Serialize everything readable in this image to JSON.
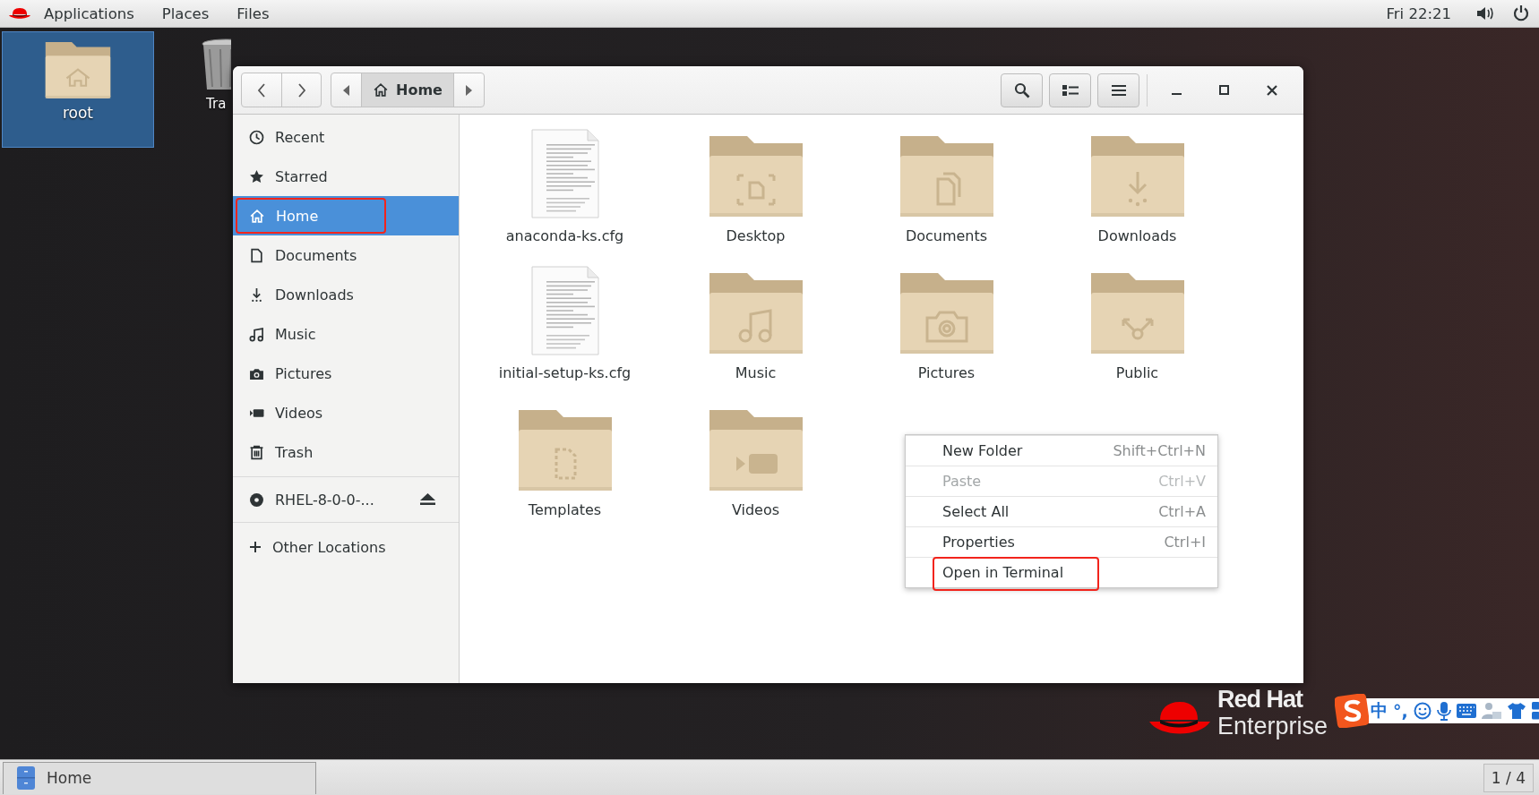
{
  "top_bar": {
    "menus": [
      "Applications",
      "Places",
      "Files"
    ],
    "clock": "Fri 22:21"
  },
  "desktop": {
    "icons": [
      {
        "label": "root",
        "kind": "homefolder",
        "selected": true
      },
      {
        "label": "Tra",
        "kind": "trash",
        "selected": false
      }
    ],
    "logo": {
      "line_1": "Red Hat",
      "line_2": "Enterprise"
    }
  },
  "window": {
    "path": {
      "label": "Home"
    },
    "sidebar": {
      "items": [
        {
          "label": "Recent",
          "kind": "recent",
          "selected": false,
          "annotated": false
        },
        {
          "label": "Starred",
          "kind": "starred",
          "selected": false,
          "annotated": false
        },
        {
          "label": "Home",
          "kind": "home",
          "selected": true,
          "annotated": true
        },
        {
          "label": "Documents",
          "kind": "documents",
          "selected": false,
          "annotated": false
        },
        {
          "label": "Downloads",
          "kind": "downloads",
          "selected": false,
          "annotated": false
        },
        {
          "label": "Music",
          "kind": "music",
          "selected": false,
          "annotated": false
        },
        {
          "label": "Pictures",
          "kind": "pictures",
          "selected": false,
          "annotated": false
        },
        {
          "label": "Videos",
          "kind": "videos",
          "selected": false,
          "annotated": false
        },
        {
          "label": "Trash",
          "kind": "trash",
          "selected": false,
          "annotated": false
        }
      ],
      "devices": [
        {
          "label": "RHEL-8-0-0-...",
          "kind": "disc"
        }
      ],
      "other_locations": {
        "label": "Other Locations"
      }
    },
    "files": [
      {
        "label": "anaconda-ks.cfg",
        "kind": "textfile"
      },
      {
        "label": "Desktop",
        "kind": "desktop"
      },
      {
        "label": "Documents",
        "kind": "documents"
      },
      {
        "label": "Downloads",
        "kind": "downloads"
      },
      {
        "label": "initial-setup-ks.cfg",
        "kind": "textfile"
      },
      {
        "label": "Music",
        "kind": "music"
      },
      {
        "label": "Pictures",
        "kind": "pictures"
      },
      {
        "label": "Public",
        "kind": "public"
      },
      {
        "label": "Templates",
        "kind": "templates"
      },
      {
        "label": "Videos",
        "kind": "videos"
      }
    ],
    "context_menu": {
      "items": [
        {
          "label": "New Folder",
          "shortcut": "Shift+Ctrl+N",
          "disabled": false,
          "annotated": false
        },
        {
          "label": "Paste",
          "shortcut": "Ctrl+V",
          "disabled": true,
          "annotated": false
        },
        {
          "label": "Select All",
          "shortcut": "Ctrl+A",
          "disabled": false,
          "annotated": false
        },
        {
          "label": "Properties",
          "shortcut": "Ctrl+I",
          "disabled": false,
          "annotated": false
        },
        {
          "label": "Open in Terminal",
          "disabled": false,
          "annotated": true
        }
      ]
    }
  },
  "taskbar": {
    "tasks": [
      {
        "label": "Home"
      }
    ],
    "workspace": "1 / 4"
  },
  "input_method": {
    "mode": "中",
    "punctuation": "°,"
  }
}
